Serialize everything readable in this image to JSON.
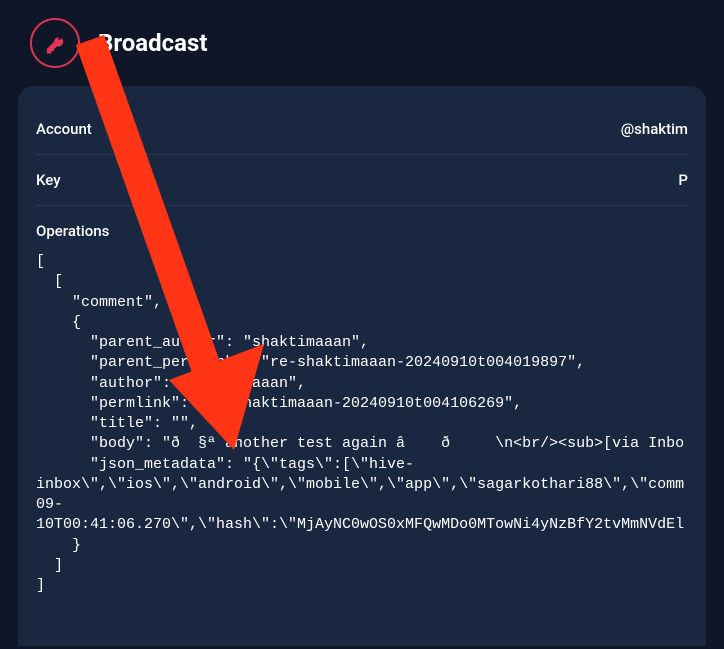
{
  "header": {
    "title": "Broadcast",
    "logo_color": "#dc3556"
  },
  "account": {
    "label": "Account",
    "value": "@shaktim"
  },
  "key": {
    "label": "Key",
    "value": "P"
  },
  "operations": {
    "label": "Operations",
    "code": "[\n  [\n    \"comment\",\n    {\n      \"parent_author\": \"shaktimaaan\",\n      \"parent_permlink\": \"re-shaktimaaan-20240910t004019897\",\n      \"author\": \"shaktimaaan\",\n      \"permlink\": \"re-shaktimaaan-20240910t004106269\",\n      \"title\": \"\",\n      \"body\": \"ð  §ª another test again â    ð     \\n<br/><sub>[via Inbo\n      \"json_metadata\": \"{\\\"tags\\\":[\\\"hive-\ninbox\\\",\\\"ios\\\",\\\"android\\\",\\\"mobile\\\",\\\"app\\\",\\\"sagarkothari88\\\",\\\"comm\n09-\n10T00:41:06.270\\\",\\\"hash\\\":\\\"MjAyNC0wOS0xMFQwMDo0MTowNi4yNzBfY2tvMmNVdEl\n    }\n  ]\n]"
  },
  "arrow": {
    "color": "#ff3515"
  }
}
